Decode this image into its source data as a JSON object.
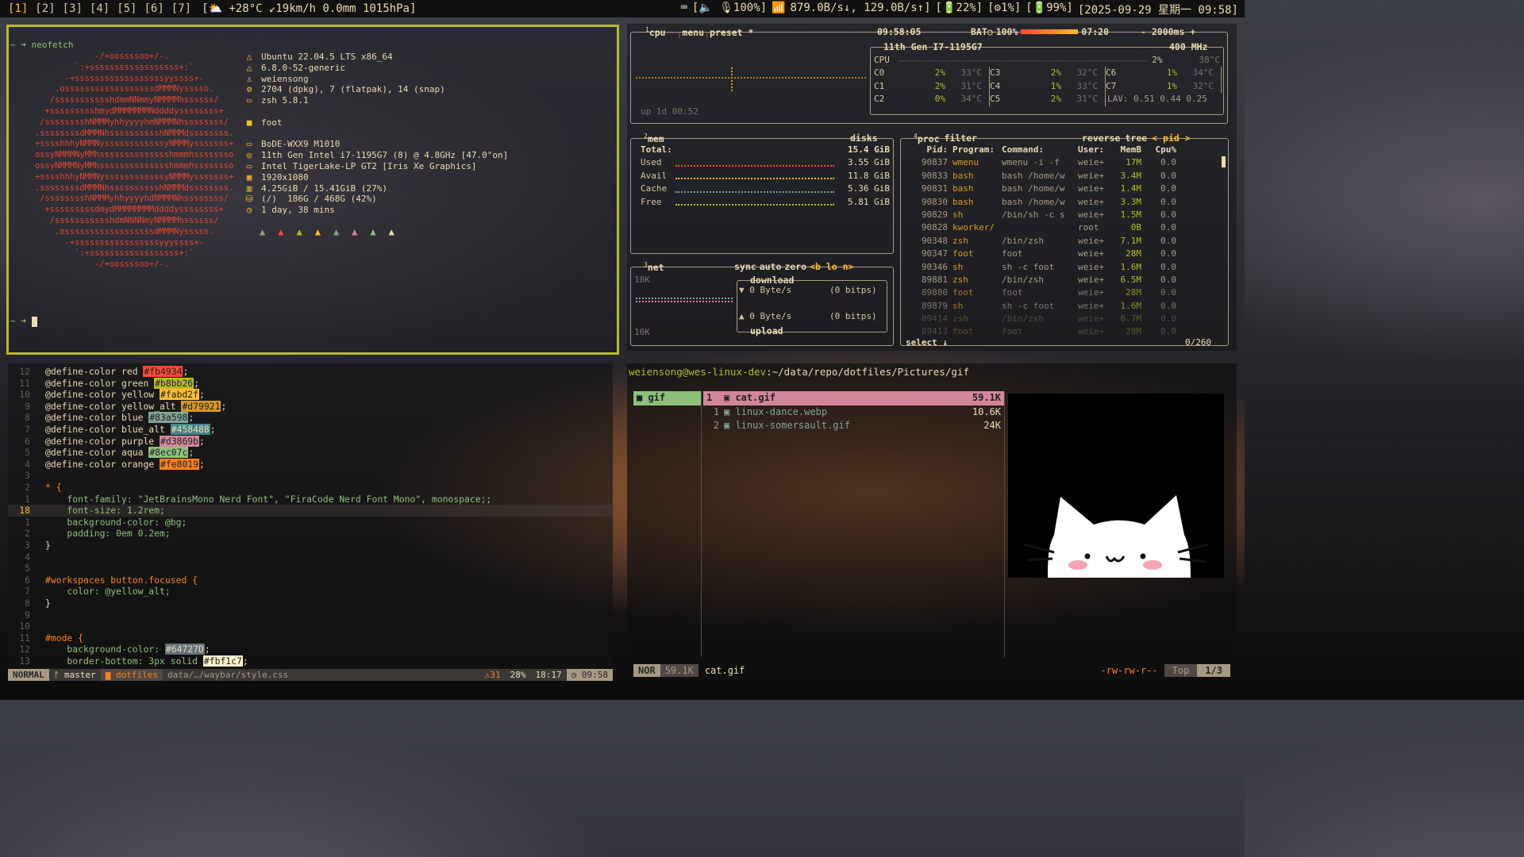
{
  "topbar": {
    "workspaces": [
      "[1]",
      "[2]",
      "[3]",
      "[4]",
      "[5]",
      "[6]",
      "[7]"
    ],
    "active_workspace": 0,
    "weather": "[⛅ +28°C ↙19km/h 0.0mm 1015hPa]",
    "kbd": "⌨",
    "volume": "[🔈 🎙100%]",
    "wifi": "📶",
    "network": "879.0B/s↓, 129.0B/s↑]",
    "battery": "[🔋22%]",
    "cpu": "[⚙1%]",
    "mem": "[🔋99%]",
    "datetime": "[2025-09-29 星期一 09:58]"
  },
  "neofetch": {
    "prompt_cmd": "~ ➜ neofetch",
    "prompt_end": "~ ➜",
    "logo_lines": [
      "                -/+oossssoo+/-.",
      "            `:+ssssssssssssssssss+:`",
      "          -+ssssssssssssssssssyyssss+-",
      "        .ossssssssssssssssssdMMMNysssso.",
      "       /ssssssssssshdmmNNmmyNMMMMhssssss/",
      "      +ssssssssshmydMMMMMMMNddddyssssssss+",
      "     /sssssssshNMMMyhhyyyyhmNMMMNhssssssss/",
      "    .ssssssssdMMMNhsssssssssshNMMMdssssssss.",
      "    +sssshhhyNMMNyssssssssssssyNMMMysssssss+",
      "    ossyNMMMNyMMhsssssssssssssshmmmhssssssso",
      "    ossyNMMMNyMMhsssssssssssssshmmmhssssssso",
      "    +sssshhhyNMMNyssssssssssssyNMMMysssssss+",
      "    .ssssssssdMMMNhsssssssssshNMMMdssssssss.",
      "     /sssssssshNMMMyhhyyyyhdNMMMNhssssssss/",
      "      +sssssssssdmydMMMMMMMMddddyssssssss+",
      "       /ssssssssssshdmNNNNmyNMMMMhssssss/",
      "        .ossssssssssssssssssdMMMNysssso.",
      "          -+sssssssssssssssssyyyssss+-",
      "            `:+ssssssssssssssssss+:`",
      "                -/+oossssoo+/-."
    ],
    "info": [
      {
        "icon": "△",
        "text": "Ubuntu 22.04.5 LTS x86_64"
      },
      {
        "icon": "△",
        "text": "6.8.0-52-generic"
      },
      {
        "icon": "♙",
        "text": "weiensong"
      },
      {
        "icon": "⚙",
        "text": "2704 (dpkg), 7 (flatpak), 14 (snap)"
      },
      {
        "icon": "▭",
        "text": "zsh 5.8.1"
      },
      {
        "icon": "",
        "text": ""
      },
      {
        "icon": "■",
        "text": "foot"
      },
      {
        "icon": "",
        "text": ""
      },
      {
        "icon": "▭",
        "text": "BoDE-WXX9 M1010"
      },
      {
        "icon": "◎",
        "text": "11th Gen Intel i7-1195G7 (8) @ 4.8GHz [47.0°on]"
      },
      {
        "icon": "▭",
        "text": "Intel TigerLake-LP GT2 [Iris Xe Graphics]"
      },
      {
        "icon": "▦",
        "text": "1920x1080"
      },
      {
        "icon": "▥",
        "text": "4.25GiB / 15.41GiB (27%)"
      },
      {
        "icon": "⛁",
        "text": "(/)  186G / 468G (42%)"
      },
      {
        "icon": "◷",
        "text": "1 day, 38 mins"
      }
    ],
    "tux_colors": [
      "#a89984",
      "#fb4934",
      "#b8bb26",
      "#fabd2f",
      "#83a598",
      "#d3869b",
      "#8ec07c",
      "#ebdbb2"
    ]
  },
  "btop": {
    "cpu_box": {
      "title_num": "1",
      "title": "cpu",
      "menu": "menu",
      "preset": "preset *",
      "clock": "09:58:05",
      "bat_label": "BAT○",
      "bat_pct": "100%",
      "bat_time": "07:20",
      "refresh": "- 2000ms +",
      "uptime": "up 1d 00:52",
      "model": "11th Gen I7-1195G7",
      "freq": "400 MHz",
      "cpu_total": {
        "label": "CPU",
        "pct": "2%",
        "temp": "38°C"
      },
      "cores": [
        {
          "label": "C0",
          "pct": "2%",
          "temp": "33°C"
        },
        {
          "label": "C3",
          "pct": "2%",
          "temp": "32°C"
        },
        {
          "label": "C6",
          "pct": "1%",
          "temp": "34°C"
        },
        {
          "label": "C1",
          "pct": "2%",
          "temp": "31°C"
        },
        {
          "label": "C4",
          "pct": "1%",
          "temp": "33°C"
        },
        {
          "label": "C7",
          "pct": "1%",
          "temp": "32°C"
        },
        {
          "label": "C2",
          "pct": "0%",
          "temp": "34°C"
        },
        {
          "label": "C5",
          "pct": "2%",
          "temp": "31°C"
        }
      ],
      "lav": "LAV: 0.51 0.44 0.25"
    },
    "mem_box": {
      "title_num": "2",
      "title": "mem",
      "disks": "disks",
      "rows": [
        {
          "label": "Total:",
          "value": "15.4 GiB"
        },
        {
          "label": "Used",
          "value": "3.55 GiB"
        },
        {
          "label": "Avail",
          "value": "11.8 GiB"
        },
        {
          "label": "Cache",
          "value": "5.36 GiB"
        },
        {
          "label": "Free",
          "value": "5.81 GiB"
        }
      ]
    },
    "net_box": {
      "title_num": "3",
      "title": "net",
      "sync": "sync",
      "auto": "auto",
      "zero": "zero",
      "iface": "<b lo n>",
      "scale_top": "10K",
      "scale_bot": "10K",
      "download_label": "download",
      "upload_label": "upload",
      "down_rate": "▼ 0 Byte/s",
      "down_bits": "(0 bitps)",
      "up_rate": "▲ 0 Byte/s",
      "up_bits": "(0 bitps)"
    },
    "proc_box": {
      "title_num": "4",
      "title": "proc",
      "filter": "filter",
      "reverse": "reverse",
      "tree": "tree",
      "sort": "< pid >",
      "headers": [
        "Pid:",
        "Program:",
        "Command:",
        "User:",
        "MemB",
        "Cpu%"
      ],
      "rows": [
        [
          "90837",
          "wmenu",
          "wmenu -i -f",
          "weie+",
          "17M",
          "0.0"
        ],
        [
          "90833",
          "bash",
          "bash /home/w",
          "weie+",
          "3.4M",
          "0.0"
        ],
        [
          "90831",
          "bash",
          "bash /home/w",
          "weie+",
          "1.4M",
          "0.0"
        ],
        [
          "90830",
          "bash",
          "bash /home/w",
          "weie+",
          "3.3M",
          "0.0"
        ],
        [
          "90829",
          "sh",
          "/bin/sh -c s",
          "weie+",
          "1.5M",
          "0.0"
        ],
        [
          "90828",
          "kworker/",
          "",
          "root",
          "0B",
          "0.0"
        ],
        [
          "90348",
          "zsh",
          "/bin/zsh",
          "weie+",
          "7.1M",
          "0.0"
        ],
        [
          "90347",
          "foot",
          "foot",
          "weie+",
          "28M",
          "0.0"
        ],
        [
          "90346",
          "sh",
          "sh -c foot",
          "weie+",
          "1.6M",
          "0.0"
        ],
        [
          "89881",
          "zsh",
          "/bin/zsh",
          "weie+",
          "6.5M",
          "0.0"
        ],
        [
          "89880",
          "foot",
          "foot",
          "weie+",
          "28M",
          "0.0"
        ],
        [
          "89879",
          "sh",
          "sh -c foot",
          "weie+",
          "1.6M",
          "0.0"
        ],
        [
          "89414",
          "zsh",
          "/bin/zsh",
          "weie+",
          "6.7M",
          "0.0"
        ],
        [
          "89413",
          "foot",
          "foot",
          "weie+",
          "28M",
          "0.0"
        ]
      ],
      "select": "select ↓",
      "count": "0/260"
    }
  },
  "editor": {
    "lines": [
      {
        "n": "12",
        "t": "@define-color red ",
        "sw": "#fb4934",
        "swc": "#fb4934"
      },
      {
        "n": "11",
        "t": "@define-color green ",
        "sw": "#b8bb26",
        "swc": "#b8bb26"
      },
      {
        "n": "10",
        "t": "@define-color yellow ",
        "sw": "#fabd2f",
        "swc": "#fabd2f"
      },
      {
        "n": "9",
        "t": "@define-color yellow_alt ",
        "sw": "#d79921",
        "swc": "#d79921"
      },
      {
        "n": "8",
        "t": "@define-color blue ",
        "sw": "#83a598",
        "swc": "#83a598"
      },
      {
        "n": "7",
        "t": "@define-color blue_alt ",
        "sw": "#458488",
        "swc": "#458488"
      },
      {
        "n": "6",
        "t": "@define-color purple ",
        "sw": "#d3869b",
        "swc": "#d3869b"
      },
      {
        "n": "5",
        "t": "@define-color aqua ",
        "sw": "#8ec07c",
        "swc": "#8ec07c"
      },
      {
        "n": "4",
        "t": "@define-color orange ",
        "sw": "#fe8019",
        "swc": "#fe8019"
      },
      {
        "n": "3",
        "t": ""
      },
      {
        "n": "2",
        "t": "* {"
      },
      {
        "n": "1",
        "t": "    font-family: \"JetBrainsMono Nerd Font\", \"FiraCode Nerd Font Mono\", monospace;;"
      },
      {
        "n": "18",
        "t": "    font-size: 1.2rem;",
        "cur": true
      },
      {
        "n": "1",
        "t": "    background-color: @bg;"
      },
      {
        "n": "2",
        "t": "    padding: 0em 0.2em;"
      },
      {
        "n": "3",
        "t": "}"
      },
      {
        "n": "4",
        "t": ""
      },
      {
        "n": "5",
        "t": ""
      },
      {
        "n": "6",
        "t": "#workspaces button.focused {"
      },
      {
        "n": "7",
        "t": "    color: @yellow_alt;"
      },
      {
        "n": "8",
        "t": "}"
      },
      {
        "n": "9",
        "t": ""
      },
      {
        "n": "10",
        "t": ""
      },
      {
        "n": "11",
        "t": "#mode {"
      },
      {
        "n": "12",
        "t": "    background-color: ",
        "sw": "#64727D",
        "swc": "#64727D",
        "tail": ";"
      },
      {
        "n": "13",
        "t": "    border-bottom: 3px solid ",
        "sw": "#fbf1c7",
        "swc": "#fbf1c7",
        "tail": ";"
      }
    ],
    "status": {
      "mode": "NORMAL",
      "branch": "ᚠ master",
      "dir": "▆ dotfiles",
      "file": "data/…/waybar/style.css",
      "diag": "⚠31",
      "pct": "28%",
      "pos": "18:17",
      "time": "◷ 09:58"
    }
  },
  "filemanager": {
    "path_user": "weiensong@wes-linux-dev",
    "path_dir": ":~/data/repo/dotfiles/Pictures/gif",
    "parent_dir": "gif",
    "files": [
      {
        "idx": "1",
        "name": "cat.gif",
        "size": "59.1K",
        "selected": true
      },
      {
        "idx": "1",
        "name": "linux-dance.webp",
        "size": "10.6K"
      },
      {
        "idx": "2",
        "name": "linux-somersault.gif",
        "size": "24K"
      }
    ],
    "status": {
      "mode": "NOR",
      "size": "59.1K",
      "name": "cat.gif",
      "perms": "-rw-rw-r--",
      "pos": "Top",
      "count": "1/3"
    }
  }
}
